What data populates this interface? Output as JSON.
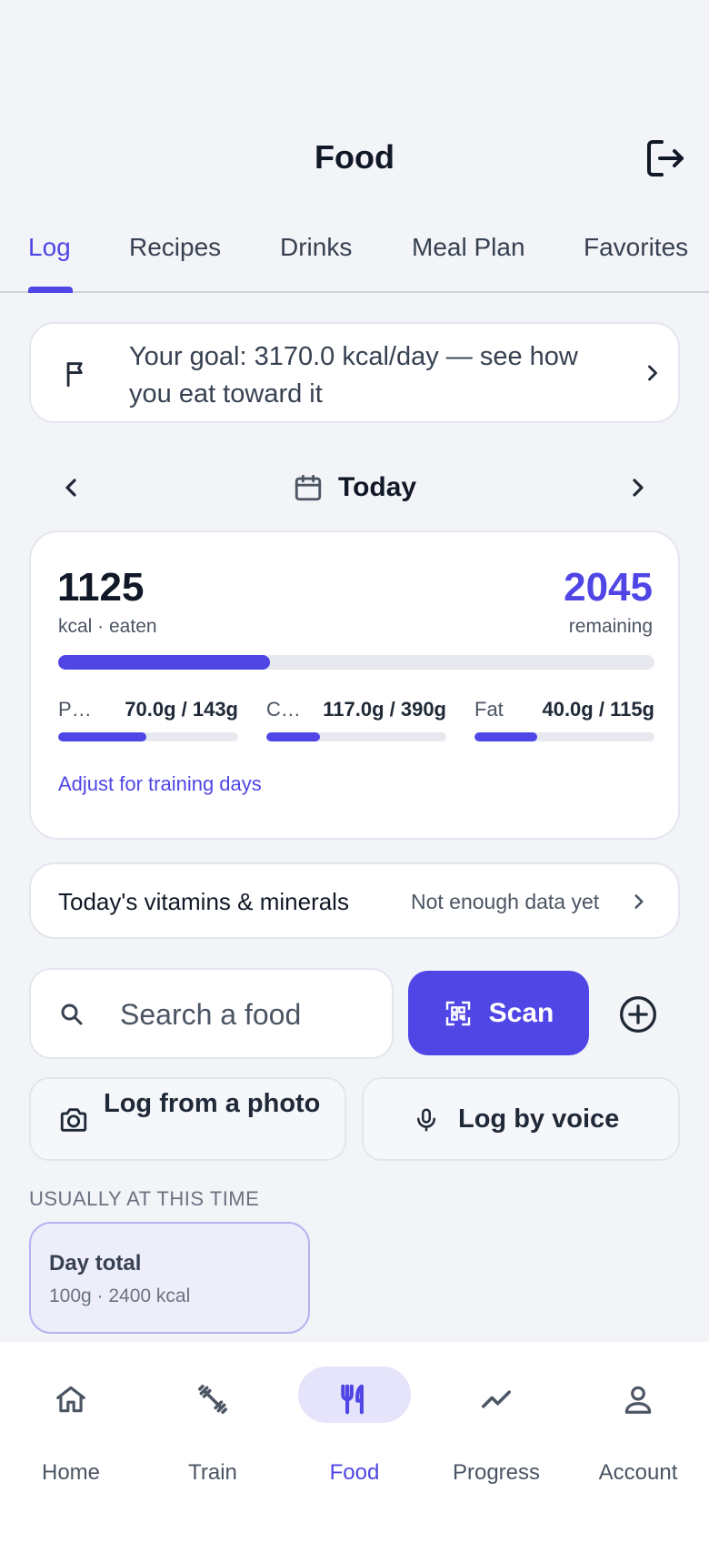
{
  "header": {
    "title": "Food",
    "logout_icon": "logout-icon"
  },
  "tabs": [
    {
      "label": "Log",
      "active": true
    },
    {
      "label": "Recipes",
      "active": false
    },
    {
      "label": "Drinks",
      "active": false
    },
    {
      "label": "Meal Plan",
      "active": false
    },
    {
      "label": "Favorites",
      "active": false
    }
  ],
  "goal_banner": {
    "text": "Your goal: 3170.0 kcal/day — see how you eat toward it",
    "icon": "flag-icon"
  },
  "date_nav": {
    "label": "Today"
  },
  "summary": {
    "eaten_value": "1125",
    "eaten_label": "kcal · eaten",
    "remaining_value": "2045",
    "remaining_label": "remaining",
    "kcal_progress": 0.355,
    "macros": [
      {
        "name": "Protein",
        "value": "70.0g / 143g",
        "progress": 0.49
      },
      {
        "name": "Carbs",
        "value": "117.0g / 390g",
        "progress": 0.3
      },
      {
        "name": "Fat",
        "value": "40.0g / 115g",
        "progress": 0.348
      }
    ],
    "adjust_link": "Adjust for training days"
  },
  "vitamins": {
    "title": "Today's vitamins & minerals",
    "status": "Not enough data yet"
  },
  "search": {
    "placeholder": "Search a food",
    "scan_label": "Scan"
  },
  "log_options": {
    "photo_label": "Log from a photo",
    "voice_label": "Log by voice"
  },
  "usual": {
    "heading": "USUALLY AT THIS TIME",
    "items": [
      {
        "title": "Day total",
        "subtitle": "100g · 2400 kcal"
      }
    ]
  },
  "bottom_nav": [
    {
      "label": "Home",
      "icon": "home-icon",
      "active": false
    },
    {
      "label": "Train",
      "icon": "dumbbell-icon",
      "active": false
    },
    {
      "label": "Food",
      "icon": "utensils-icon",
      "active": true
    },
    {
      "label": "Progress",
      "icon": "trend-icon",
      "active": false
    },
    {
      "label": "Account",
      "icon": "user-icon",
      "active": false
    }
  ],
  "colors": {
    "accent": "#4f46e5",
    "background": "#f3f4f8",
    "track": "#e8e9ee"
  }
}
